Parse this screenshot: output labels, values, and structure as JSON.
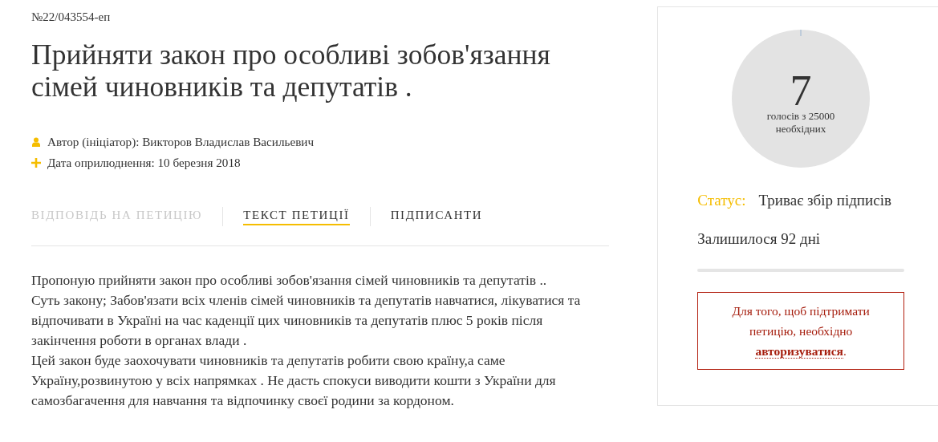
{
  "petition": {
    "number": "№22/043554-еп",
    "title": "Прийняти закон про особливі зобов'язання сімей чиновників та депутатів .",
    "meta": [
      {
        "kind": "author",
        "text": "Автор (ініціатор): Викторов Владислав Васильевич"
      },
      {
        "kind": "date",
        "text": "Дата оприлюднення: 10 березня 2018"
      }
    ]
  },
  "tabs": [
    {
      "label": "ВІДПОВІДЬ НА ПЕТИЦІЮ",
      "selected": false,
      "disabled": true
    },
    {
      "label": "ТЕКСТ ПЕТИЦІЇ",
      "selected": true,
      "disabled": false
    },
    {
      "label": "ПІДПИСАНТИ",
      "selected": false,
      "disabled": false
    }
  ],
  "body": [
    "Пропоную прийняти закон про особливі зобов'язання сімей чиновників та депутатів ..",
    "Суть закону; Забов'язати всіх членів сімей чиновників та депутатів навчатися, лікуватися та відпочивати в Україні на час каденції цих чиновників та депутатів плюс 5 років після закінчення роботи в органах влади .",
    "Цей закон буде заохочувати чиновників та депутатів робити свою країну,а саме Україну,розвинутою у всіх напрямках . Не дасть спокуси виводити кошти з України для самозбагачення для навчання та відпочинку своєї родини за кордоном."
  ],
  "sidebar": {
    "votes": {
      "count": "7",
      "caption": "голосів з 25000 необхідних"
    },
    "status": {
      "label": "Статус:",
      "value": "Триває збір підписів"
    },
    "remaining": "Залишилося 92 дні",
    "notice": {
      "text": "Для того, щоб підтримати петицію, необхідно",
      "link": "авторизуватися",
      "end": "."
    }
  }
}
